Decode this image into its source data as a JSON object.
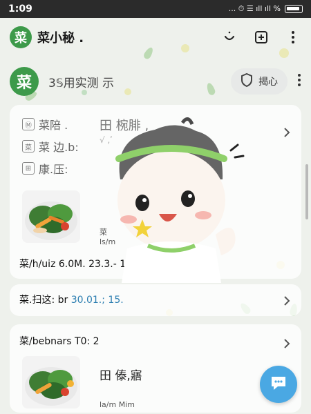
{
  "status_bar": {
    "time": "1:09",
    "icons_text": "... ⏱ ☰ ıll ıll %"
  },
  "app_bar": {
    "logo_char": "菜",
    "title": "菜小秘 ."
  },
  "sub_header": {
    "avatar_char": "菜",
    "text": "3𝕊用实测 示",
    "care_label": "揭心"
  },
  "card1": {
    "menu_items": [
      {
        "icon": "Ⓜ",
        "label": "菜陪 ."
      },
      {
        "icon": "菜",
        "label": "菜 边.b:"
      },
      {
        "icon": "⊞",
        "label": "康.压:"
      }
    ],
    "title": "田 椀腓 ,",
    "subtitle": "√ ,ʹ",
    "thumb_caption_a": "菜",
    "thumb_caption_b": "ls/m",
    "info_line": "菜/h/uiz 6.0M. 23.3.- 1 P.3' : 11:"
  },
  "card2": {
    "label": "菜.扫这: br",
    "value": "30.01.; 15."
  },
  "card3": {
    "header": "菜/bebnars T0: 2",
    "title": "田 傣,寤",
    "caption": "la/m Mim"
  },
  "colors": {
    "accent_green": "#3d9a4a",
    "fab_blue": "#4aa8e3",
    "link_blue": "#2a7db0"
  },
  "icons": [
    "smile-icon",
    "plus-square-icon",
    "more-vertical-icon",
    "shield-icon",
    "chevron-right-icon",
    "chat-icon"
  ]
}
